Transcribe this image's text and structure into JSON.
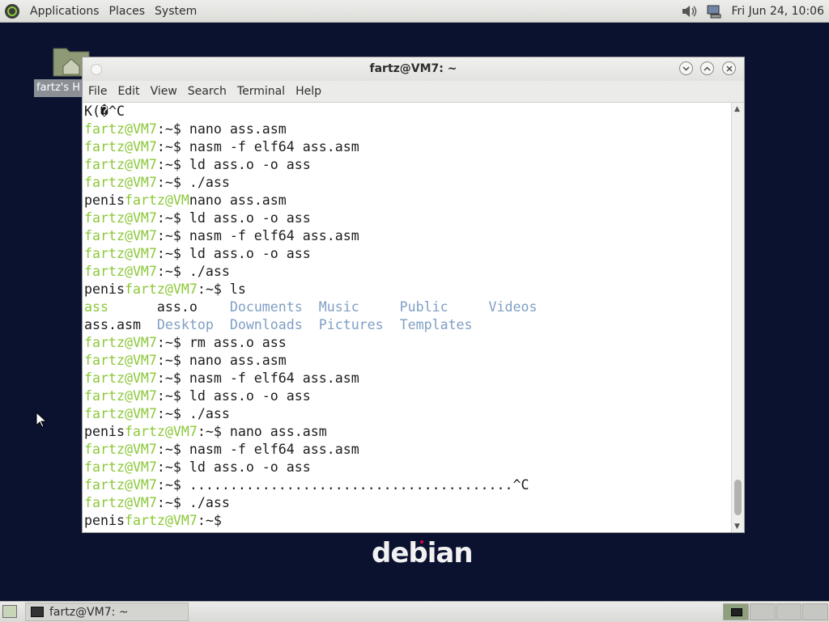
{
  "top_panel": {
    "menus": [
      "Applications",
      "Places",
      "System"
    ],
    "clock": "Fri Jun 24, 10:06"
  },
  "desktop": {
    "home_icon_label": "fartz's H",
    "logo_text": "debian"
  },
  "terminal": {
    "title": "fartz@VM7: ~",
    "menu": [
      "File",
      "Edit",
      "View",
      "Search",
      "Terminal",
      "Help"
    ],
    "prompt": "fartz@VM7",
    "lines": [
      [
        {
          "t": "K(�^C"
        }
      ],
      [
        {
          "t": "fartz@VM7",
          "c": "p"
        },
        {
          "t": ":~$ nano ass.asm"
        }
      ],
      [
        {
          "t": "fartz@VM7",
          "c": "p"
        },
        {
          "t": ":~$ nasm -f elf64 ass.asm"
        }
      ],
      [
        {
          "t": "fartz@VM7",
          "c": "p"
        },
        {
          "t": ":~$ ld ass.o -o ass"
        }
      ],
      [
        {
          "t": "fartz@VM7",
          "c": "p"
        },
        {
          "t": ":~$ ./ass"
        }
      ],
      [
        {
          "t": "penis"
        },
        {
          "t": "fartz@VM",
          "c": "p"
        },
        {
          "t": "nano ass.asm"
        }
      ],
      [
        {
          "t": "fartz@VM7",
          "c": "p"
        },
        {
          "t": ":~$ ld ass.o -o ass"
        }
      ],
      [
        {
          "t": "fartz@VM7",
          "c": "p"
        },
        {
          "t": ":~$ nasm -f elf64 ass.asm"
        }
      ],
      [
        {
          "t": "fartz@VM7",
          "c": "p"
        },
        {
          "t": ":~$ ld ass.o -o ass"
        }
      ],
      [
        {
          "t": "fartz@VM7",
          "c": "p"
        },
        {
          "t": ":~$ ./ass"
        }
      ],
      [
        {
          "t": "penis"
        },
        {
          "t": "fartz@VM7",
          "c": "p"
        },
        {
          "t": ":~$ ls"
        }
      ],
      [
        {
          "t": "ass",
          "c": "p"
        },
        {
          "t": "      ass.o    "
        },
        {
          "t": "Documents  Music     Public     Videos",
          "c": "d"
        }
      ],
      [
        {
          "t": "ass.asm  "
        },
        {
          "t": "Desktop  Downloads  Pictures  Templates",
          "c": "d"
        }
      ],
      [
        {
          "t": "fartz@VM7",
          "c": "p"
        },
        {
          "t": ":~$ rm ass.o ass"
        }
      ],
      [
        {
          "t": "fartz@VM7",
          "c": "p"
        },
        {
          "t": ":~$ nano ass.asm"
        }
      ],
      [
        {
          "t": "fartz@VM7",
          "c": "p"
        },
        {
          "t": ":~$ nasm -f elf64 ass.asm"
        }
      ],
      [
        {
          "t": "fartz@VM7",
          "c": "p"
        },
        {
          "t": ":~$ ld ass.o -o ass"
        }
      ],
      [
        {
          "t": "fartz@VM7",
          "c": "p"
        },
        {
          "t": ":~$ ./ass"
        }
      ],
      [
        {
          "t": "penis"
        },
        {
          "t": "fartz@VM7",
          "c": "p"
        },
        {
          "t": ":~$ nano ass.asm"
        }
      ],
      [
        {
          "t": "fartz@VM7",
          "c": "p"
        },
        {
          "t": ":~$ nasm -f elf64 ass.asm"
        }
      ],
      [
        {
          "t": "fartz@VM7",
          "c": "p"
        },
        {
          "t": ":~$ ld ass.o -o ass"
        }
      ],
      [
        {
          "t": "fartz@VM7",
          "c": "p"
        },
        {
          "t": ":~$ ........................................^C"
        }
      ],
      [
        {
          "t": "fartz@VM7",
          "c": "p"
        },
        {
          "t": ":~$ ./ass"
        }
      ],
      [
        {
          "t": "penis"
        },
        {
          "t": "fartz@VM7",
          "c": "p"
        },
        {
          "t": ":~$ "
        }
      ]
    ]
  },
  "taskbar": {
    "task_label": "fartz@VM7: ~"
  },
  "colors": {
    "prompt_green": "#8cc83a",
    "dir_blue": "#7f9fc4",
    "desktop_bg": "#0b1230"
  }
}
